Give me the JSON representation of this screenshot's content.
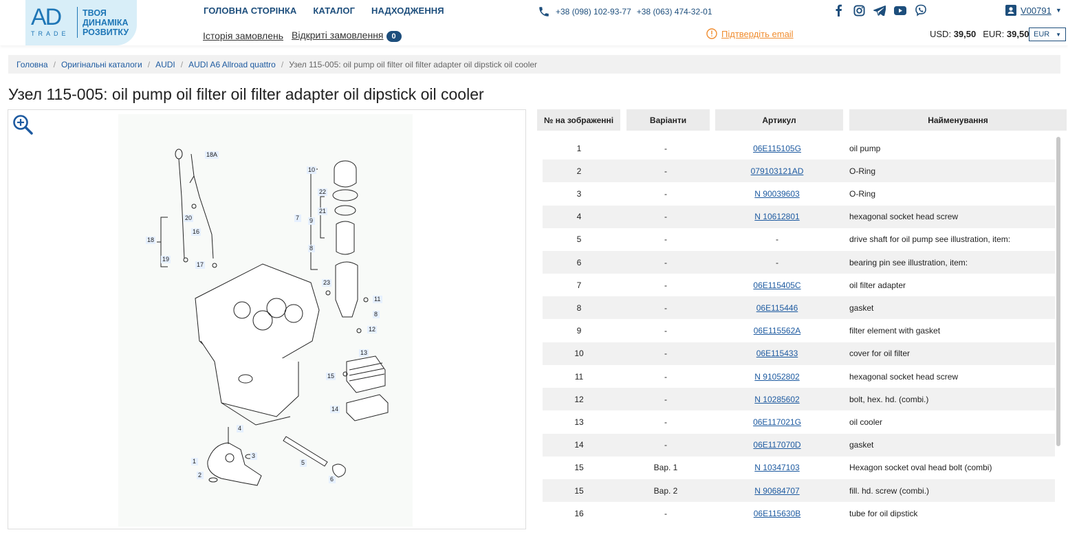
{
  "logo": {
    "mark": "AD",
    "sub": "TRADE",
    "tagline": [
      "ТВОЯ",
      "ДИНАМІКА",
      "РОЗВИТКУ"
    ]
  },
  "nav": {
    "items": [
      "ГОЛОВНА СТОРІНКА",
      "КАТАЛОГ",
      "НАДХОДЖЕННЯ"
    ]
  },
  "subnav": {
    "history": "Історія замовлень",
    "open_orders": "Відкриті замовлення",
    "open_count": "0"
  },
  "phones": [
    "+38 (098) 102-93-77",
    "+38 (063) 474-32-01"
  ],
  "socials": [
    "facebook-icon",
    "instagram-icon",
    "telegram-icon",
    "youtube-icon",
    "viber-icon"
  ],
  "account": {
    "id": "V00791"
  },
  "confirm_email": "Підтвердіть email",
  "rates": {
    "usd_label": "USD:",
    "usd_value": "39,50",
    "eur_label": "EUR:",
    "eur_value": "39,50",
    "currency": "EUR"
  },
  "breadcrumbs": [
    "Головна",
    "Оригінальні каталоги",
    "AUDI",
    "AUDI A6 Allroad quattro"
  ],
  "breadcrumb_current": "Узел 115-005: oil pump oil filter oil filter adapter oil dipstick oil cooler",
  "title": "Узел 115-005: oil pump oil filter oil filter adapter oil dipstick oil cooler",
  "diagram_labels": [
    "18A",
    "10",
    "22",
    "21",
    "7",
    "9",
    "8",
    "20",
    "16",
    "18",
    "19",
    "17",
    "23",
    "11",
    "8",
    "12",
    "13",
    "15",
    "14",
    "4",
    "3",
    "1",
    "2",
    "5",
    "6"
  ],
  "table": {
    "headers": [
      "№ на зображенні",
      "Варіанти",
      "Артикул",
      "Найменування"
    ],
    "rows": [
      {
        "num": "1",
        "variant": "-",
        "article": "06E115105G",
        "name": "oil pump"
      },
      {
        "num": "2",
        "variant": "-",
        "article": "079103121AD",
        "name": "O-Ring"
      },
      {
        "num": "3",
        "variant": "-",
        "article": "N 90039603",
        "name": "O-Ring"
      },
      {
        "num": "4",
        "variant": "-",
        "article": "N 10612801",
        "name": "hexagonal socket head screw"
      },
      {
        "num": "5",
        "variant": "-",
        "article": "-",
        "name": "drive shaft for oil pump see illustration, item:"
      },
      {
        "num": "6",
        "variant": "-",
        "article": "-",
        "name": "bearing pin see illustration, item:"
      },
      {
        "num": "7",
        "variant": "-",
        "article": "06E115405C",
        "name": "oil filter adapter"
      },
      {
        "num": "8",
        "variant": "-",
        "article": "06E115446",
        "name": "gasket"
      },
      {
        "num": "9",
        "variant": "-",
        "article": "06E115562A",
        "name": "filter element with gasket"
      },
      {
        "num": "10",
        "variant": "-",
        "article": "06E115433",
        "name": "cover for oil filter"
      },
      {
        "num": "11",
        "variant": "-",
        "article": "N 91052802",
        "name": "hexagonal socket head screw"
      },
      {
        "num": "12",
        "variant": "-",
        "article": "N 10285602",
        "name": "bolt, hex. hd. (combi.)"
      },
      {
        "num": "13",
        "variant": "-",
        "article": "06E117021G",
        "name": "oil cooler"
      },
      {
        "num": "14",
        "variant": "-",
        "article": "06E117070D",
        "name": "gasket"
      },
      {
        "num": "15",
        "variant": "Вар. 1",
        "article": "N 10347103",
        "name": "Hexagon socket oval head bolt (combi)"
      },
      {
        "num": "15",
        "variant": "Вар. 2",
        "article": "N 90684707",
        "name": "fill. hd. screw (combi.)"
      },
      {
        "num": "16",
        "variant": "-",
        "article": "06E115630B",
        "name": "tube for oil dipstick"
      }
    ]
  }
}
